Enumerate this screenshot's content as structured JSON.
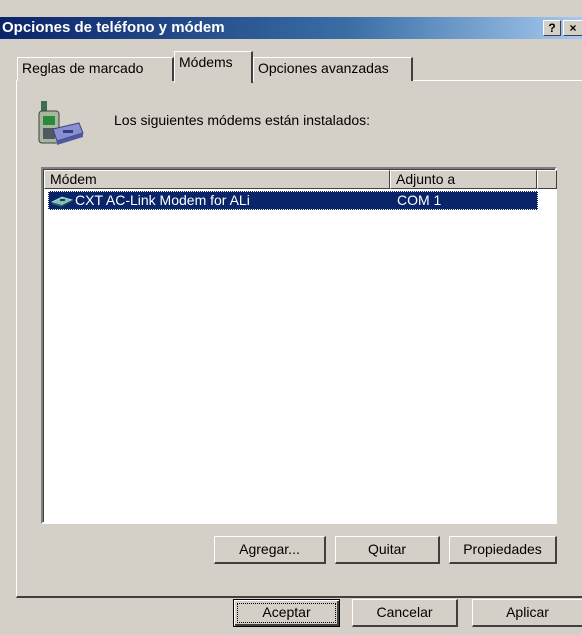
{
  "window": {
    "title": "Opciones de teléfono y módem",
    "help_label": "?",
    "close_label": "×"
  },
  "tabs": [
    {
      "label": "Reglas de marcado",
      "active": false
    },
    {
      "label": "Módems",
      "active": true
    },
    {
      "label": "Opciones avanzadas",
      "active": false
    }
  ],
  "main": {
    "intro": "Los siguientes módems están instalados:",
    "modem_icon": "modem-phone-icon"
  },
  "list": {
    "columns": [
      "Módem",
      "Adjunto a"
    ],
    "rows": [
      {
        "name": "CXT AC-Link Modem for ALi",
        "port": "COM 1",
        "selected": true,
        "icon": "modem-device-icon"
      }
    ]
  },
  "buttons": {
    "add": "Agregar...",
    "remove": "Quitar",
    "properties": "Propiedades",
    "ok": "Aceptar",
    "cancel": "Cancelar",
    "apply": "Aplicar"
  },
  "colors": {
    "title_bar": "#0a246a",
    "face": "#d4d0c8",
    "selection": "#0a246a"
  }
}
